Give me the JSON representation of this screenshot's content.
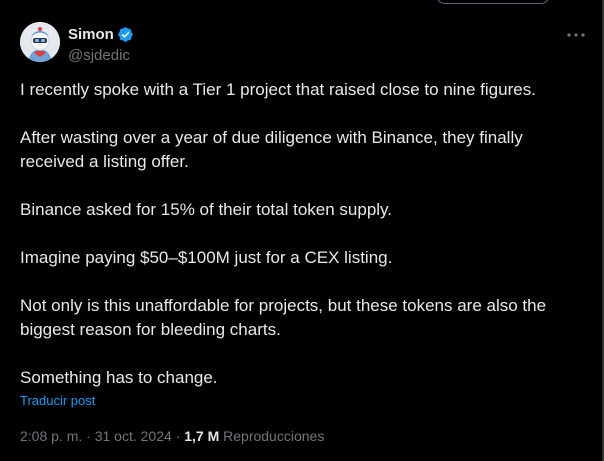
{
  "author": {
    "display_name": "Simon",
    "handle": "@sjdedic",
    "verified": true
  },
  "tweet": {
    "paragraphs": [
      "I recently spoke with a Tier 1 project that raised close to nine figures.",
      "After wasting over a year of due diligence with Binance, they finally received a listing offer.",
      "Binance asked for 15% of their total token supply.",
      "Imagine paying $50–$100M just for a CEX listing.",
      "Not only is this unaffordable for projects, but these tokens are also the biggest reason for bleeding charts.",
      "Something has to change."
    ],
    "translate_label": "Traducir post"
  },
  "meta": {
    "time": "2:08 p. m.",
    "separator": "·",
    "date": "31 oct. 2024",
    "views_count": "1,7 M",
    "views_label": "Reproducciones"
  },
  "icons": {
    "verified": "verified-badge-icon",
    "more": "more-options-icon"
  },
  "colors": {
    "background": "#000000",
    "text_primary": "#e7e9ea",
    "text_secondary": "#71767b",
    "accent": "#1d9bf0"
  }
}
